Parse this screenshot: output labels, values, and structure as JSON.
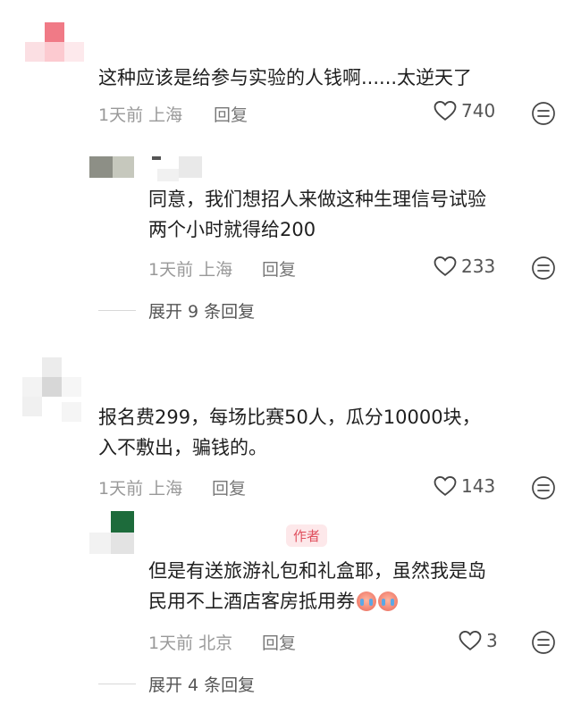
{
  "comments": [
    {
      "text_lines": [
        "这种应该是给参与实验的人钱啊......太逆天了"
      ],
      "time": "1天前",
      "location": "上海",
      "reply_label": "回复",
      "likes": "740",
      "replies": [
        {
          "text_lines": [
            "同意，我们想招人来做这种生理信号试验",
            "两个小时就得给200"
          ],
          "time": "1天前",
          "location": "上海",
          "reply_label": "回复",
          "likes": "233"
        }
      ],
      "expand_label": "展开 9 条回复"
    },
    {
      "text_lines": [
        "报名费299，每场比赛50人，瓜分10000块，",
        "入不敷出，骗钱的。"
      ],
      "time": "1天前",
      "location": "上海",
      "reply_label": "回复",
      "likes": "143",
      "replies": [
        {
          "author_badge": "作者",
          "text_lines": [
            "但是有送旅游礼包和礼盒耶，虽然我是岛",
            "民用不上酒店客房抵用券"
          ],
          "time": "1天前",
          "location": "北京",
          "reply_label": "回复",
          "likes": "3"
        }
      ],
      "expand_label": "展开 4 条回复"
    }
  ],
  "icons": {
    "like": "heart-outline-icon",
    "more": "more-options-icon",
    "emoji": "crying-face-emoji"
  },
  "colors": {
    "badge_bg": "#fde8ea",
    "badge_text": "#e0505e",
    "meta": "#999999"
  }
}
